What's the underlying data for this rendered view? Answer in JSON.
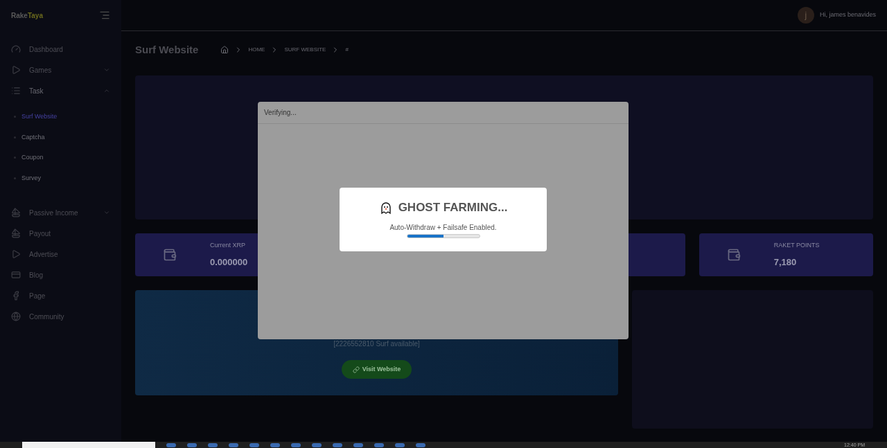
{
  "brand": {
    "part1": "Rake",
    "part2": "Taya"
  },
  "user": {
    "initial": "j",
    "greeting": "Hi, james benavides"
  },
  "sidebar": {
    "items": [
      {
        "label": "Dashboard"
      },
      {
        "label": "Games",
        "expanded": false
      },
      {
        "label": "Task",
        "expanded": true,
        "children": [
          {
            "label": "Surf Website",
            "selected": true
          },
          {
            "label": "Captcha",
            "selected": false
          },
          {
            "label": "Coupon",
            "selected": false
          },
          {
            "label": "Survey",
            "selected": false
          }
        ]
      },
      {
        "label": "Passive Income",
        "expanded": false
      },
      {
        "label": "Payout"
      },
      {
        "label": "Advertise"
      },
      {
        "label": "Blog"
      },
      {
        "label": "Page"
      },
      {
        "label": "Community"
      }
    ]
  },
  "page": {
    "title": "Surf Website",
    "breadcrumb": [
      "HOME",
      "SURF WEBSITE",
      "#"
    ]
  },
  "stats": [
    {
      "label": "Current XRP",
      "value": "0.000000"
    },
    {
      "label": "RAKET POINTS",
      "value": "7,180"
    }
  ],
  "surf_card": {
    "info": "[2226552810 Surf available]",
    "button": "Visit Website"
  },
  "modal": {
    "title": "Verifying...",
    "heading": "GHOST FARMING...",
    "subtitle": "Auto-Withdraw + Failsafe Enabled.",
    "level": 0.5
  },
  "taskbar": {
    "time": "12:40 PM"
  }
}
